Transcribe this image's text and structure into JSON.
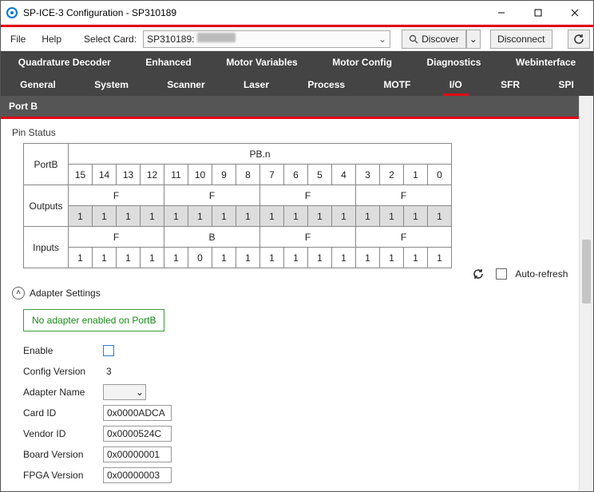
{
  "window": {
    "title": "SP-ICE-3 Configuration - SP310189"
  },
  "menu": {
    "file": "File",
    "help": "Help",
    "selectCardLabel": "Select Card:",
    "selectedCard": "SP310189:",
    "discover": "Discover",
    "disconnect": "Disconnect"
  },
  "tabs": {
    "row1": [
      "Quadrature Decoder",
      "Enhanced",
      "Motor Variables",
      "Motor Config",
      "Diagnostics",
      "Webinterface"
    ],
    "row2": [
      "General",
      "System",
      "Scanner",
      "Laser",
      "Process",
      "MOTF",
      "I/O",
      "SFR",
      "SPI"
    ],
    "active": "I/O"
  },
  "section": {
    "header": "Port B"
  },
  "pinstatus": {
    "label": "Pin Status",
    "rowHeader": "PortB",
    "colHeader": "PB.n",
    "bits": [
      "15",
      "14",
      "13",
      "12",
      "11",
      "10",
      "9",
      "8",
      "7",
      "6",
      "5",
      "4",
      "3",
      "2",
      "1",
      "0"
    ],
    "outputsLabel": "Outputs",
    "outputsHex": [
      "F",
      "F",
      "F",
      "F"
    ],
    "outputsBits": [
      "1",
      "1",
      "1",
      "1",
      "1",
      "1",
      "1",
      "1",
      "1",
      "1",
      "1",
      "1",
      "1",
      "1",
      "1",
      "1"
    ],
    "inputsLabel": "Inputs",
    "inputsHex": [
      "F",
      "B",
      "F",
      "F"
    ],
    "inputsBits": [
      "1",
      "1",
      "1",
      "1",
      "1",
      "0",
      "1",
      "1",
      "1",
      "1",
      "1",
      "1",
      "1",
      "1",
      "1",
      "1"
    ],
    "autoRefresh": "Auto-refresh"
  },
  "adapter": {
    "toggleLabel": "Adapter Settings",
    "status": "No adapter enabled on PortB",
    "fields": {
      "enableLabel": "Enable",
      "configVersionLabel": "Config Version",
      "configVersion": "3",
      "adapterNameLabel": "Adapter Name",
      "adapterName": "",
      "cardIdLabel": "Card ID",
      "cardId": "0x0000ADCA",
      "vendorIdLabel": "Vendor ID",
      "vendorId": "0x0000524C",
      "boardVersionLabel": "Board Version",
      "boardVersion": "0x00000001",
      "fpgaVersionLabel": "FPGA Version",
      "fpgaVersion": "0x00000003"
    }
  }
}
